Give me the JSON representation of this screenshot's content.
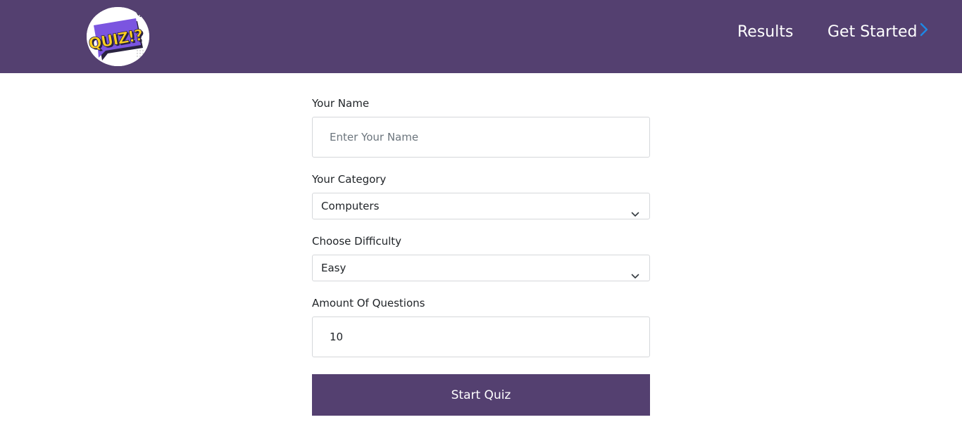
{
  "logo": {
    "text": "QUIZ!?"
  },
  "nav": {
    "results": "Results",
    "get_started": "Get Started"
  },
  "form": {
    "name_label": "Your Name",
    "name_placeholder": "Enter Your Name",
    "name_value": "",
    "category_label": "Your Category",
    "category_value": "Computers",
    "difficulty_label": "Choose Difficulty",
    "difficulty_value": "Easy",
    "amount_label": "Amount Of Questions",
    "amount_value": "10",
    "submit_label": "Start Quiz"
  },
  "colors": {
    "brand": "#544070",
    "chevron_accent": "#1e88e5"
  }
}
